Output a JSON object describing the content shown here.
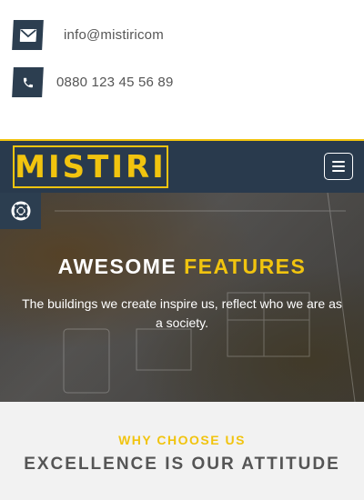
{
  "contact": {
    "email": "info@mistiricom",
    "phone": "0880 123 45 56 89"
  },
  "navbar": {
    "logo_text": "MISTIRI"
  },
  "hero": {
    "title_white": "AWESOME",
    "title_highlight": "FEATURES",
    "subtitle": "The buildings we create inspire us, reflect who we are as a society."
  },
  "why": {
    "kicker": "WHY CHOOSE US",
    "title": "EXCELLENCE IS OUR ATTITUDE"
  },
  "colors": {
    "accent": "#f1c40f",
    "navy": "#293a4d",
    "icon_bg": "#2c3e50"
  },
  "icons": {
    "email": "envelope-icon",
    "phone": "phone-icon",
    "menu": "hamburger-icon",
    "settings": "lifebuoy-icon"
  }
}
